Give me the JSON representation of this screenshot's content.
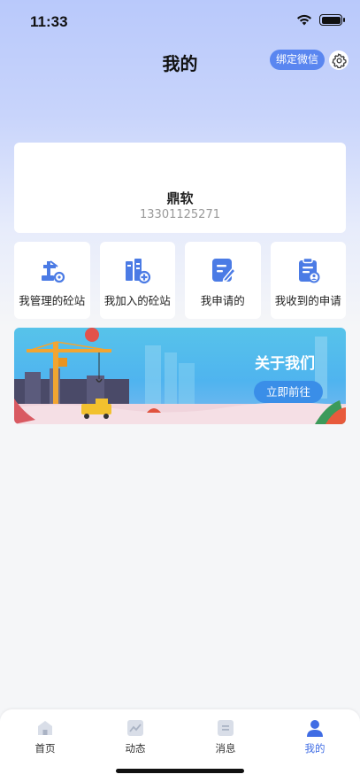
{
  "status": {
    "time": "11:33"
  },
  "header": {
    "title": "我的",
    "bind_wechat_label": "绑定微信"
  },
  "profile": {
    "name": "鼎软",
    "phone": "13301125271"
  },
  "grid": [
    {
      "label": "我管理的砼站",
      "icon": "crane-gear-icon"
    },
    {
      "label": "我加入的砼站",
      "icon": "plant-add-icon"
    },
    {
      "label": "我申请的",
      "icon": "edit-document-icon"
    },
    {
      "label": "我收到的申请",
      "icon": "received-document-icon"
    }
  ],
  "banner": {
    "title": "关于我们",
    "button_label": "立即前往"
  },
  "tabbar": [
    {
      "label": "首页",
      "icon": "home-icon"
    },
    {
      "label": "动态",
      "icon": "chart-icon"
    },
    {
      "label": "消息",
      "icon": "message-icon"
    },
    {
      "label": "我的",
      "icon": "user-icon",
      "active": true
    }
  ],
  "colors": {
    "accent": "#5a86f0",
    "active_tab": "#3f6ce4",
    "icon_blue": "#4b7be5"
  }
}
